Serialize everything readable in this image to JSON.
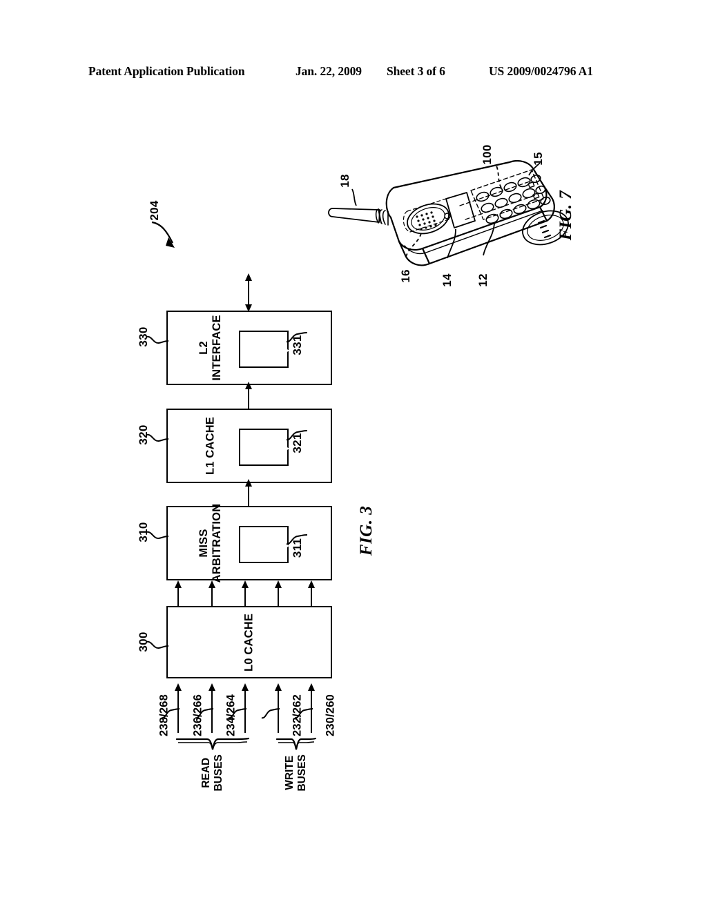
{
  "header": {
    "publication": "Patent Application Publication",
    "date": "Jan. 22, 2009",
    "sheet": "Sheet 3 of 6",
    "document_number": "US 2009/0024796 A1"
  },
  "figures": [
    {
      "caption": "FIG. 3",
      "system_ref": "204",
      "blocks": [
        {
          "ref": "330",
          "label": "L2\nINTERFACE",
          "inner_ref": "331"
        },
        {
          "ref": "320",
          "label": "L1 CACHE",
          "inner_ref": "321"
        },
        {
          "ref": "310",
          "label": "MISS\nARBITRATION",
          "inner_ref": "311"
        },
        {
          "ref": "300",
          "label": "L0 CACHE",
          "inner_ref": null
        }
      ],
      "buses": [
        {
          "label": "238/268"
        },
        {
          "label": "236/266"
        },
        {
          "label": "234/264"
        },
        {
          "label": "232/262"
        },
        {
          "label": "230/260"
        }
      ],
      "bus_groups": [
        {
          "label": "READ\nBUSES"
        },
        {
          "label": "WRITE\nBUSES"
        }
      ]
    },
    {
      "caption": "FIG. 7",
      "title": "wireless handset",
      "callouts": [
        {
          "ref": "18",
          "part": "antenna"
        },
        {
          "ref": "100",
          "part": "integrated-circuit"
        },
        {
          "ref": "15",
          "part": "housing"
        },
        {
          "ref": "16",
          "part": "speaker"
        },
        {
          "ref": "14",
          "part": "display"
        },
        {
          "ref": "12",
          "part": "keypad"
        }
      ]
    }
  ],
  "colors": {
    "ink": "#000000",
    "paper": "#ffffff"
  }
}
